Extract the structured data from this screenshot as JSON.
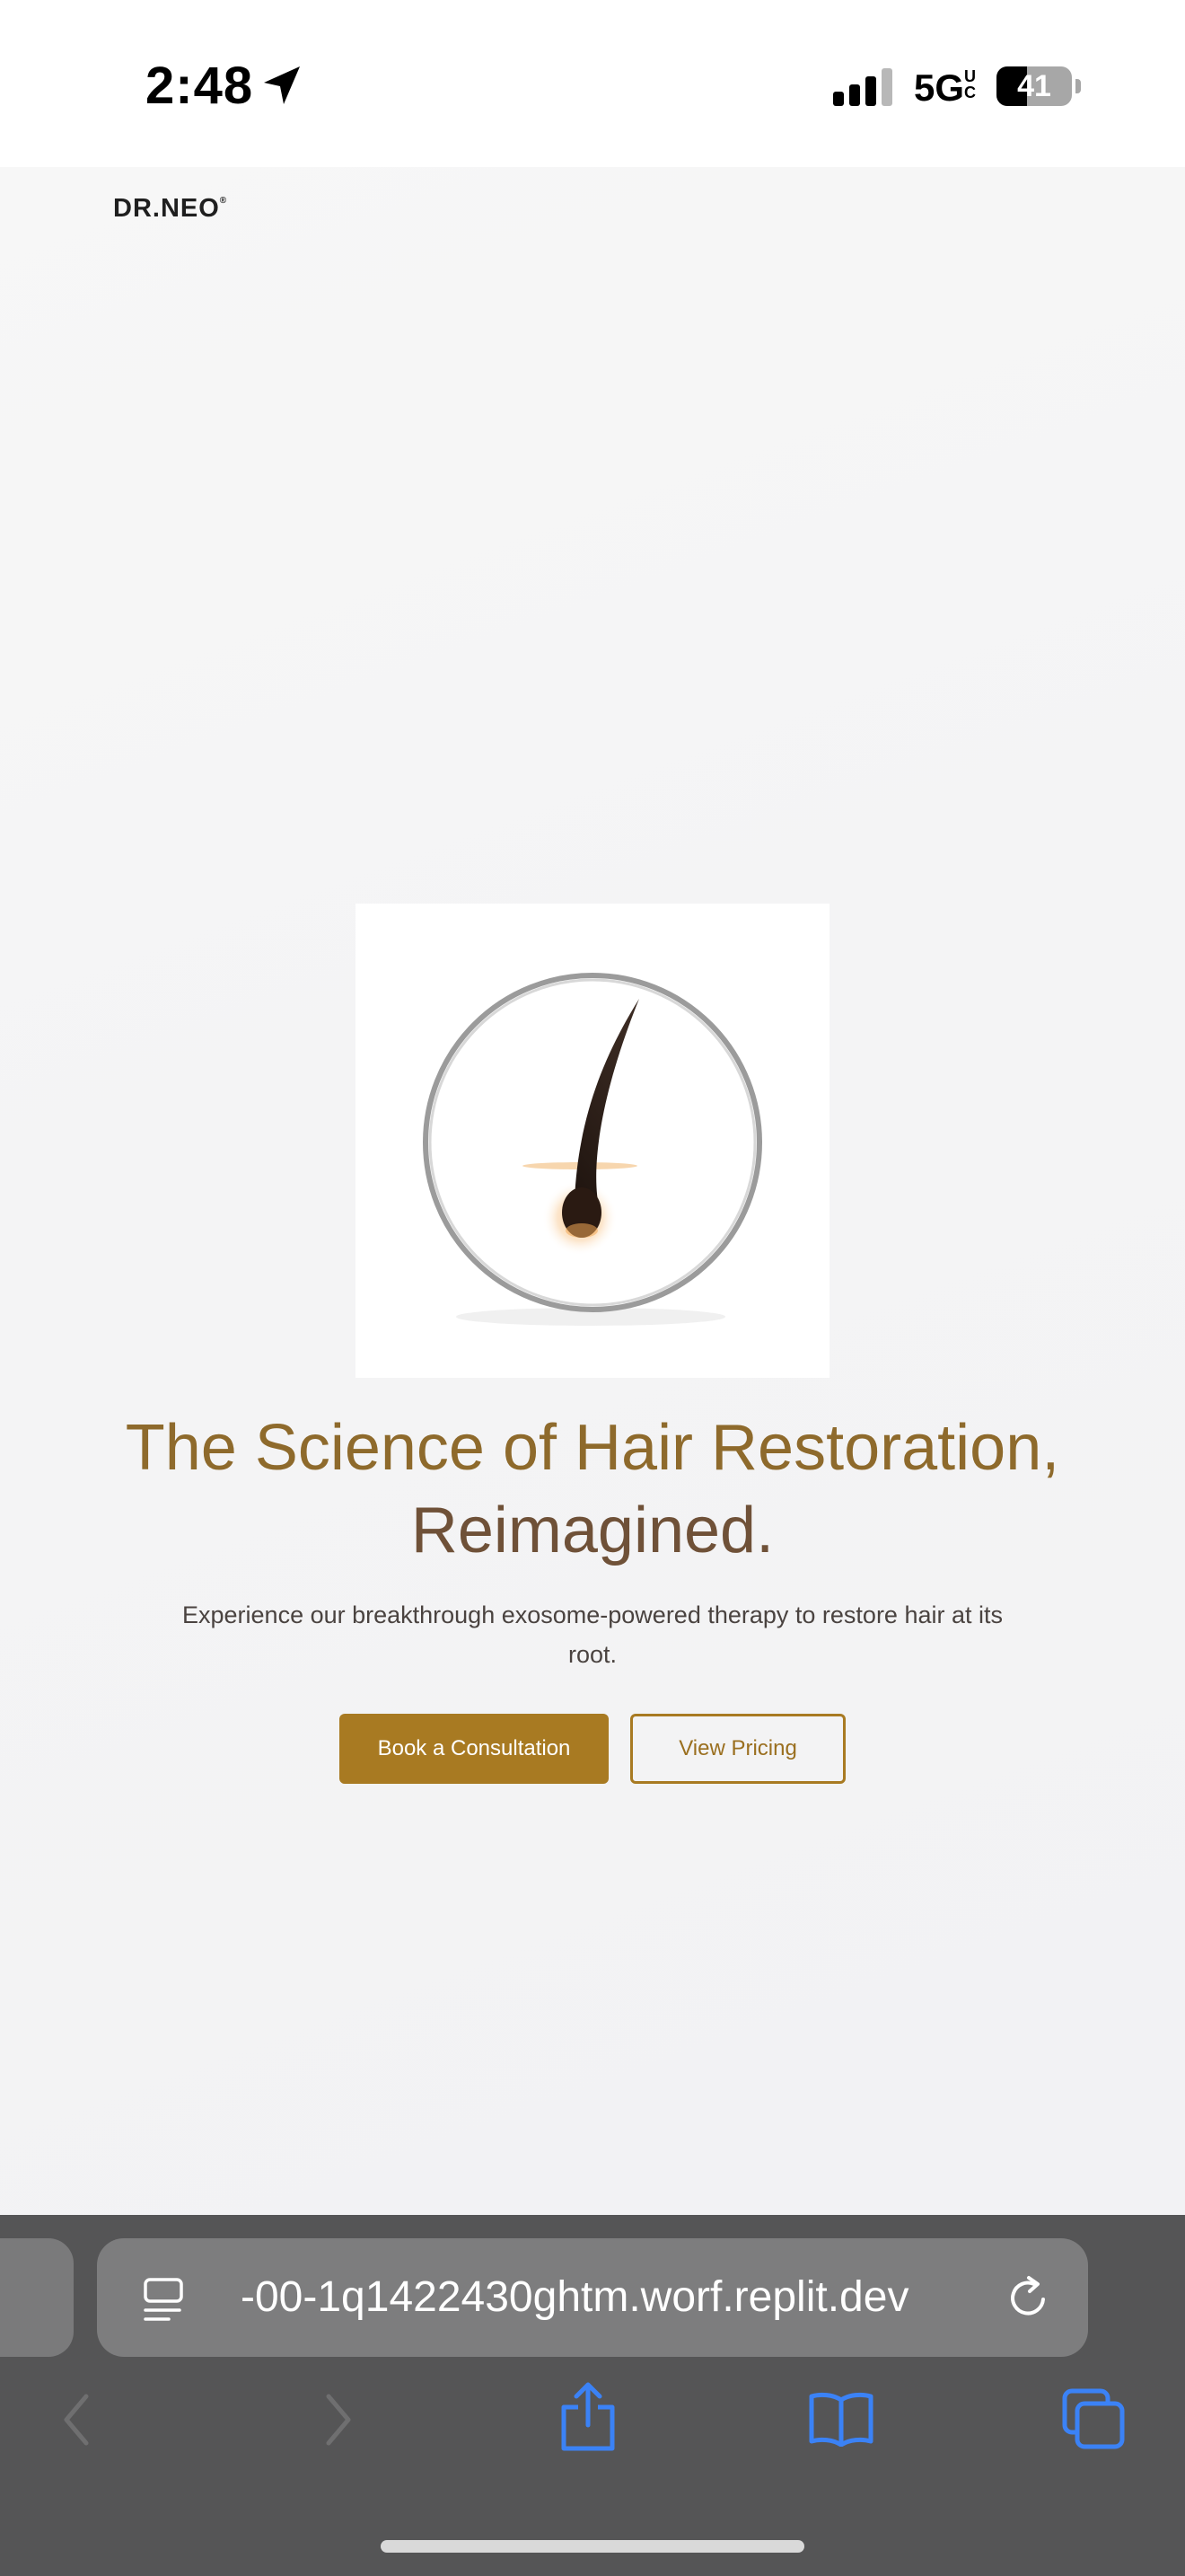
{
  "status_bar": {
    "time": "2:48",
    "network": "5G",
    "network_suffix": "UC",
    "battery_percent": 41,
    "battery_label": "41"
  },
  "header": {
    "logo_text": "DR.NEO",
    "logo_mark": "®"
  },
  "hero": {
    "image_icon": "hair-follicle-icon",
    "title_line1": "The Science of Hair Restoration,",
    "title_line2": "Reimagined.",
    "subtitle": "Experience our breakthrough exosome-powered therapy to restore hair at its root.",
    "primary_button": "Book a Consultation",
    "secondary_button": "View Pricing"
  },
  "browser": {
    "url": "-00-1q1422430ghtm.worf.replit.dev",
    "toolbar": [
      "back-icon",
      "forward-icon",
      "share-icon",
      "bookmarks-icon",
      "tabs-icon"
    ]
  },
  "colors": {
    "accent": "#a87a22",
    "title_gold": "#8e6a2c",
    "title_brown": "#6f5138",
    "browser_bar": "#555556",
    "ios_blue": "#3b82f6"
  }
}
